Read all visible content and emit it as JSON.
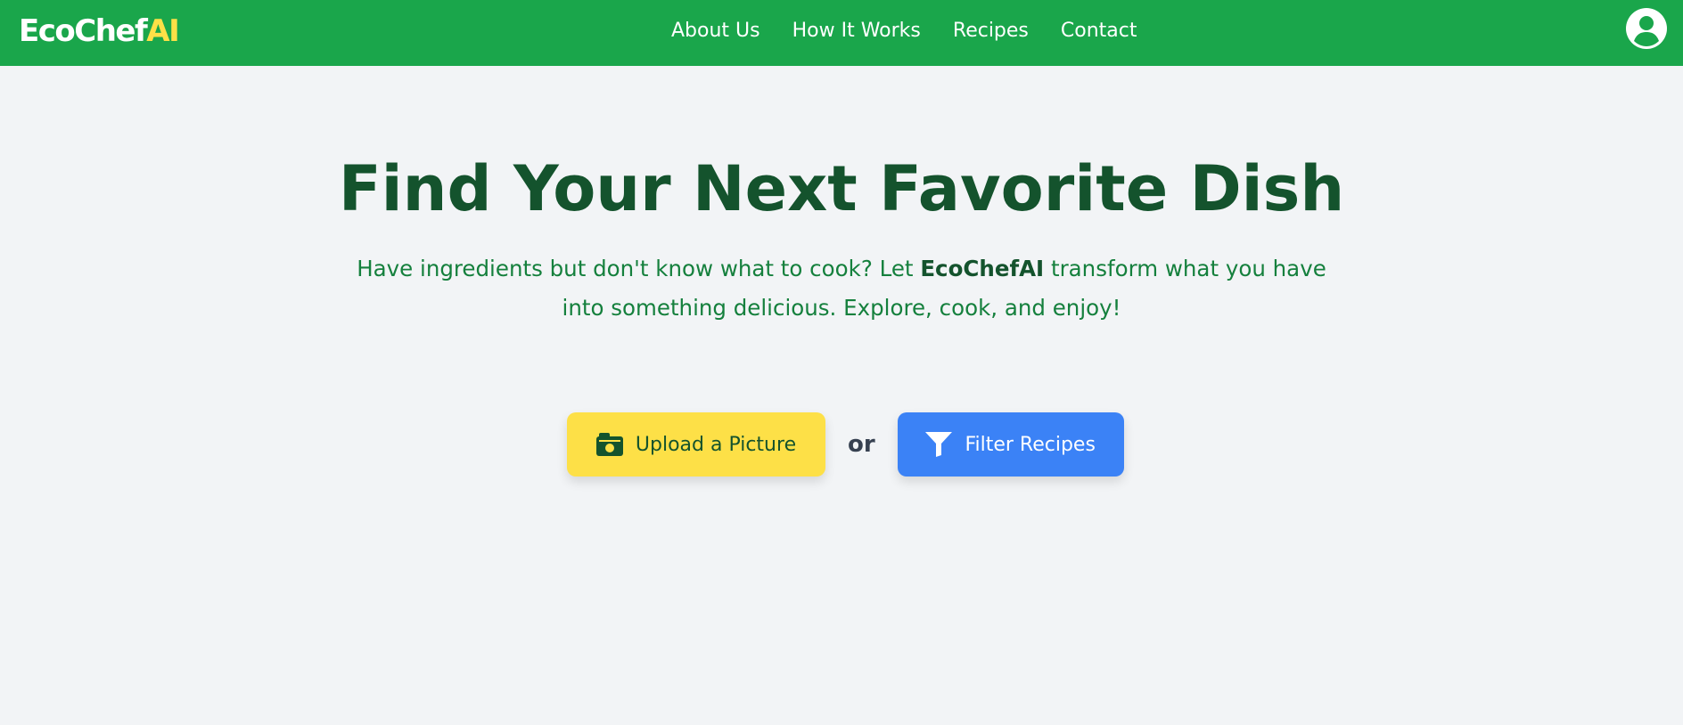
{
  "brand": {
    "main": "EcoChef",
    "accent": "AI"
  },
  "nav": {
    "items": [
      {
        "label": "About Us"
      },
      {
        "label": "How It Works"
      },
      {
        "label": "Recipes"
      },
      {
        "label": "Contact"
      }
    ]
  },
  "profile": {
    "icon": "user-circle-icon"
  },
  "hero": {
    "title": "Find Your Next Favorite Dish",
    "subtitle_pre": "Have ingredients but don't know what to cook? Let ",
    "subtitle_brand": "EcoChefAI",
    "subtitle_post": " transform what you have into something delicious. Explore, cook, and enjoy!"
  },
  "actions": {
    "upload_label": "Upload a Picture",
    "upload_icon": "camera-icon",
    "or_label": "or",
    "filter_label": "Filter Recipes",
    "filter_icon": "filter-icon"
  },
  "colors": {
    "header_bg": "#1aa64b",
    "brand_accent": "#fde047",
    "title": "#14532d",
    "subtitle": "#15803d",
    "upload_bg": "#fde047",
    "filter_bg": "#3b82f6",
    "page_bg": "#f2f4f6"
  }
}
